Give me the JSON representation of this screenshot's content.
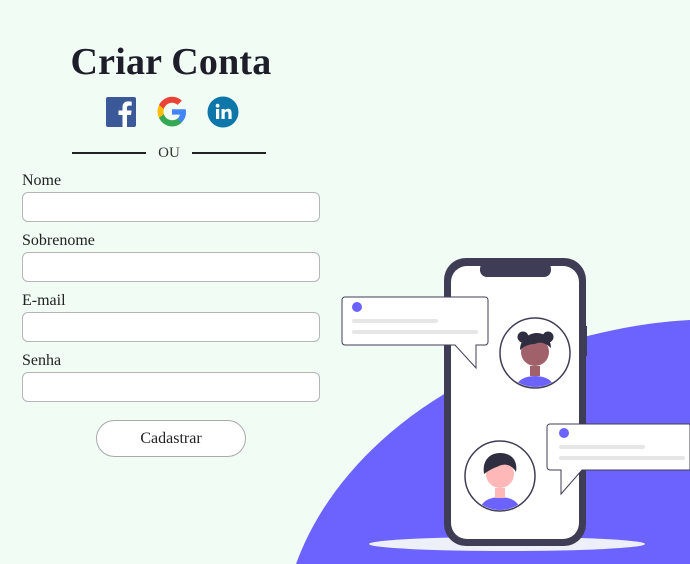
{
  "form": {
    "title": "Criar Conta",
    "divider_text": "OU",
    "fields": [
      {
        "label": "Nome",
        "value": "",
        "placeholder": ""
      },
      {
        "label": "Sobrenome",
        "value": "",
        "placeholder": ""
      },
      {
        "label": "E-mail",
        "value": "",
        "placeholder": ""
      },
      {
        "label": "Senha",
        "value": "",
        "placeholder": ""
      }
    ],
    "submit_label": "Cadastrar"
  },
  "socials": [
    {
      "icon": "facebook-icon",
      "color": "#3b5998"
    },
    {
      "icon": "google-icon",
      "color": "#4285f4"
    },
    {
      "icon": "linkedin-icon",
      "color": "#0e76a8"
    }
  ],
  "colors": {
    "background": "#f1fcf5",
    "accent": "#6c63ff",
    "phone_frame": "#3f3d56"
  }
}
